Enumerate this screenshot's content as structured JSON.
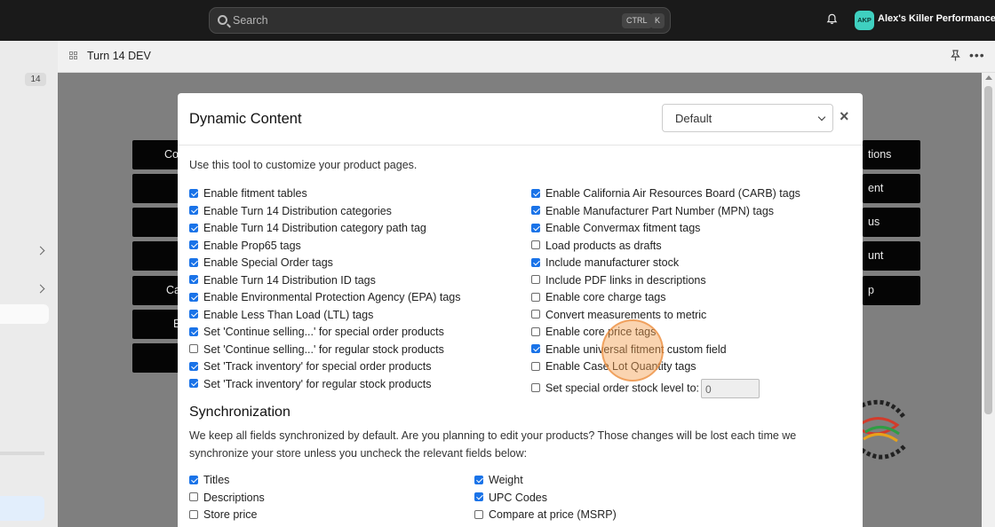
{
  "topbar": {
    "search_placeholder": "Search",
    "kbd_ctrl": "CTRL",
    "kbd_k": "K",
    "avatar_initials": "AKP",
    "store_name": "Alex's Killer Performance"
  },
  "sidebar": {
    "badge": "14"
  },
  "app": {
    "title": "Turn 14 DEV",
    "more": "•••"
  },
  "background": {
    "left_buttons": [
      "Co",
      "",
      "",
      "",
      "Ca",
      "E",
      ""
    ],
    "right_buttons": [
      "tions",
      "ent",
      "us",
      "unt",
      "p"
    ]
  },
  "modal": {
    "title": "Dynamic Content",
    "profile_select": "Default",
    "close": "×",
    "intro": "Use this tool to customize your product pages.",
    "left_options": [
      {
        "label": "Enable fitment tables",
        "checked": true
      },
      {
        "label": "Enable Turn 14 Distribution categories",
        "checked": true
      },
      {
        "label": "Enable Turn 14 Distribution category path tag",
        "checked": true
      },
      {
        "label": "Enable Prop65 tags",
        "checked": true
      },
      {
        "label": "Enable Special Order tags",
        "checked": true
      },
      {
        "label": "Enable Turn 14 Distribution ID tags",
        "checked": true
      },
      {
        "label": "Enable Environmental Protection Agency (EPA) tags",
        "checked": true
      },
      {
        "label": "Enable Less Than Load (LTL) tags",
        "checked": true
      },
      {
        "label": "Set 'Continue selling...' for special order products",
        "checked": true
      },
      {
        "label": "Set 'Continue selling...' for regular stock products",
        "checked": false
      },
      {
        "label": "Set 'Track inventory' for special order products",
        "checked": true
      },
      {
        "label": "Set 'Track inventory' for regular stock products",
        "checked": true
      }
    ],
    "right_options": [
      {
        "label": "Enable California Air Resources Board (CARB) tags",
        "checked": true
      },
      {
        "label": "Enable Manufacturer Part Number (MPN) tags",
        "checked": true
      },
      {
        "label": "Enable Convermax fitment tags",
        "checked": true
      },
      {
        "label": "Load products as drafts",
        "checked": false
      },
      {
        "label": "Include manufacturer stock",
        "checked": true
      },
      {
        "label": "Include PDF links in descriptions",
        "checked": false
      },
      {
        "label": "Enable core charge tags",
        "checked": false
      },
      {
        "label": "Convert measurements to metric",
        "checked": false
      },
      {
        "label": "Enable core price tags",
        "checked": false
      },
      {
        "label": "Enable universal fitment custom field",
        "checked": true
      },
      {
        "label": "Enable Case Lot Quantity tags",
        "checked": false
      },
      {
        "label": "Set special order stock level to:",
        "checked": false
      }
    ],
    "stock_level_value": "0",
    "sync_heading": "Synchronization",
    "sync_text": "We keep all fields synchronized by default. Are you planning to edit your products? Those changes will be lost each time we synchronize your store unless you uncheck the relevant fields below:",
    "sync_left": [
      {
        "label": "Titles",
        "checked": true
      },
      {
        "label": "Descriptions",
        "checked": false
      },
      {
        "label": "Store price",
        "checked": false
      }
    ],
    "sync_right": [
      {
        "label": "Weight",
        "checked": true
      },
      {
        "label": "UPC Codes",
        "checked": true
      },
      {
        "label": "Compare at price (MSRP)",
        "checked": false
      }
    ]
  },
  "colors": {
    "accent": "#1a73e8",
    "topbar": "#1a1a1a",
    "avatar": "#3fd0c0"
  }
}
